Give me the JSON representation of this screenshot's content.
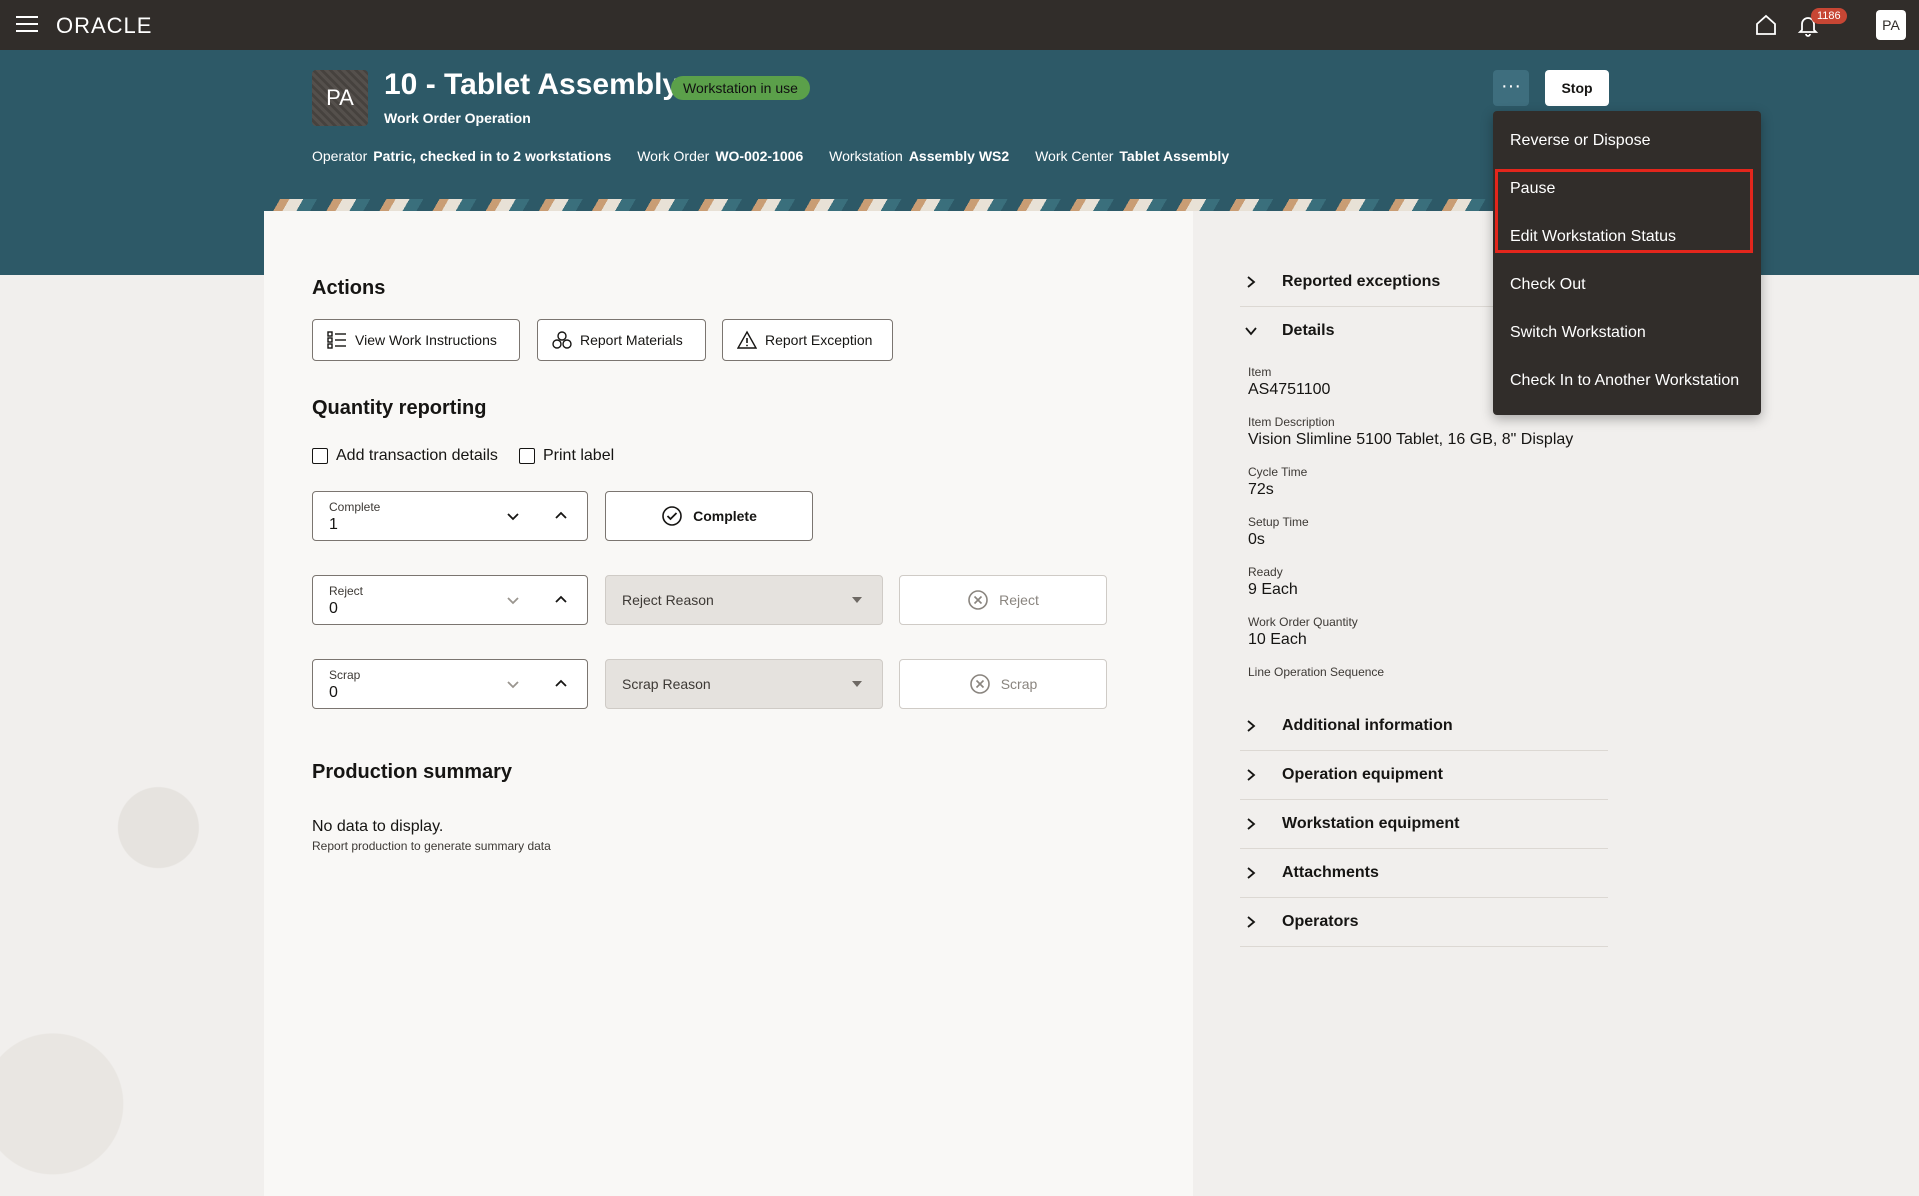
{
  "topbar": {
    "logo": "ORACLE",
    "notifications_count": "1186",
    "user_initials": "PA"
  },
  "header": {
    "avatar_initials": "PA",
    "title": "10 - Tablet Assembly",
    "status_badge": "Workstation in use",
    "subtitle": "Work Order Operation",
    "meta": {
      "operator_label": "Operator",
      "operator_value": "Patric, checked in to 2 workstations",
      "work_order_label": "Work Order",
      "work_order_value": "WO-002-1006",
      "workstation_label": "Workstation",
      "workstation_value": "Assembly WS2",
      "work_center_label": "Work Center",
      "work_center_value": "Tablet Assembly"
    },
    "more_label": "···",
    "stop_label": "Stop"
  },
  "menu": {
    "items": [
      "Reverse or Dispose",
      "Pause",
      "Edit Workstation Status",
      "Check Out",
      "Switch Workstation",
      "Check In to Another Workstation"
    ]
  },
  "actions": {
    "title": "Actions",
    "view_instructions": "View Work Instructions",
    "report_materials": "Report Materials",
    "report_exception": "Report Exception"
  },
  "quantity": {
    "title": "Quantity reporting",
    "add_transaction_details": "Add transaction details",
    "print_label": "Print label",
    "complete": {
      "label": "Complete",
      "value": "1",
      "button": "Complete"
    },
    "reject": {
      "label": "Reject",
      "value": "0",
      "reason_placeholder": "Reject Reason",
      "button": "Reject"
    },
    "scrap": {
      "label": "Scrap",
      "value": "0",
      "reason_placeholder": "Scrap Reason",
      "button": "Scrap"
    }
  },
  "production_summary": {
    "title": "Production summary",
    "empty": "No data to display.",
    "hint": "Report production to generate summary data"
  },
  "side": {
    "reported_exceptions": "Reported exceptions",
    "details": "Details",
    "item_label": "Item",
    "item_value": "AS4751100",
    "item_desc_label": "Item Description",
    "item_desc_value": "Vision Slimline 5100 Tablet, 16 GB, 8\" Display",
    "cycle_label": "Cycle Time",
    "cycle_value": "72s",
    "setup_label": "Setup Time",
    "setup_value": "0s",
    "ready_label": "Ready",
    "ready_value": "9 Each",
    "woq_label": "Work Order Quantity",
    "woq_value": "10 Each",
    "line_op_label": "Line Operation Sequence",
    "additional_info": "Additional information",
    "operation_equipment": "Operation equipment",
    "workstation_equipment": "Workstation equipment",
    "attachments": "Attachments",
    "operators": "Operators"
  }
}
